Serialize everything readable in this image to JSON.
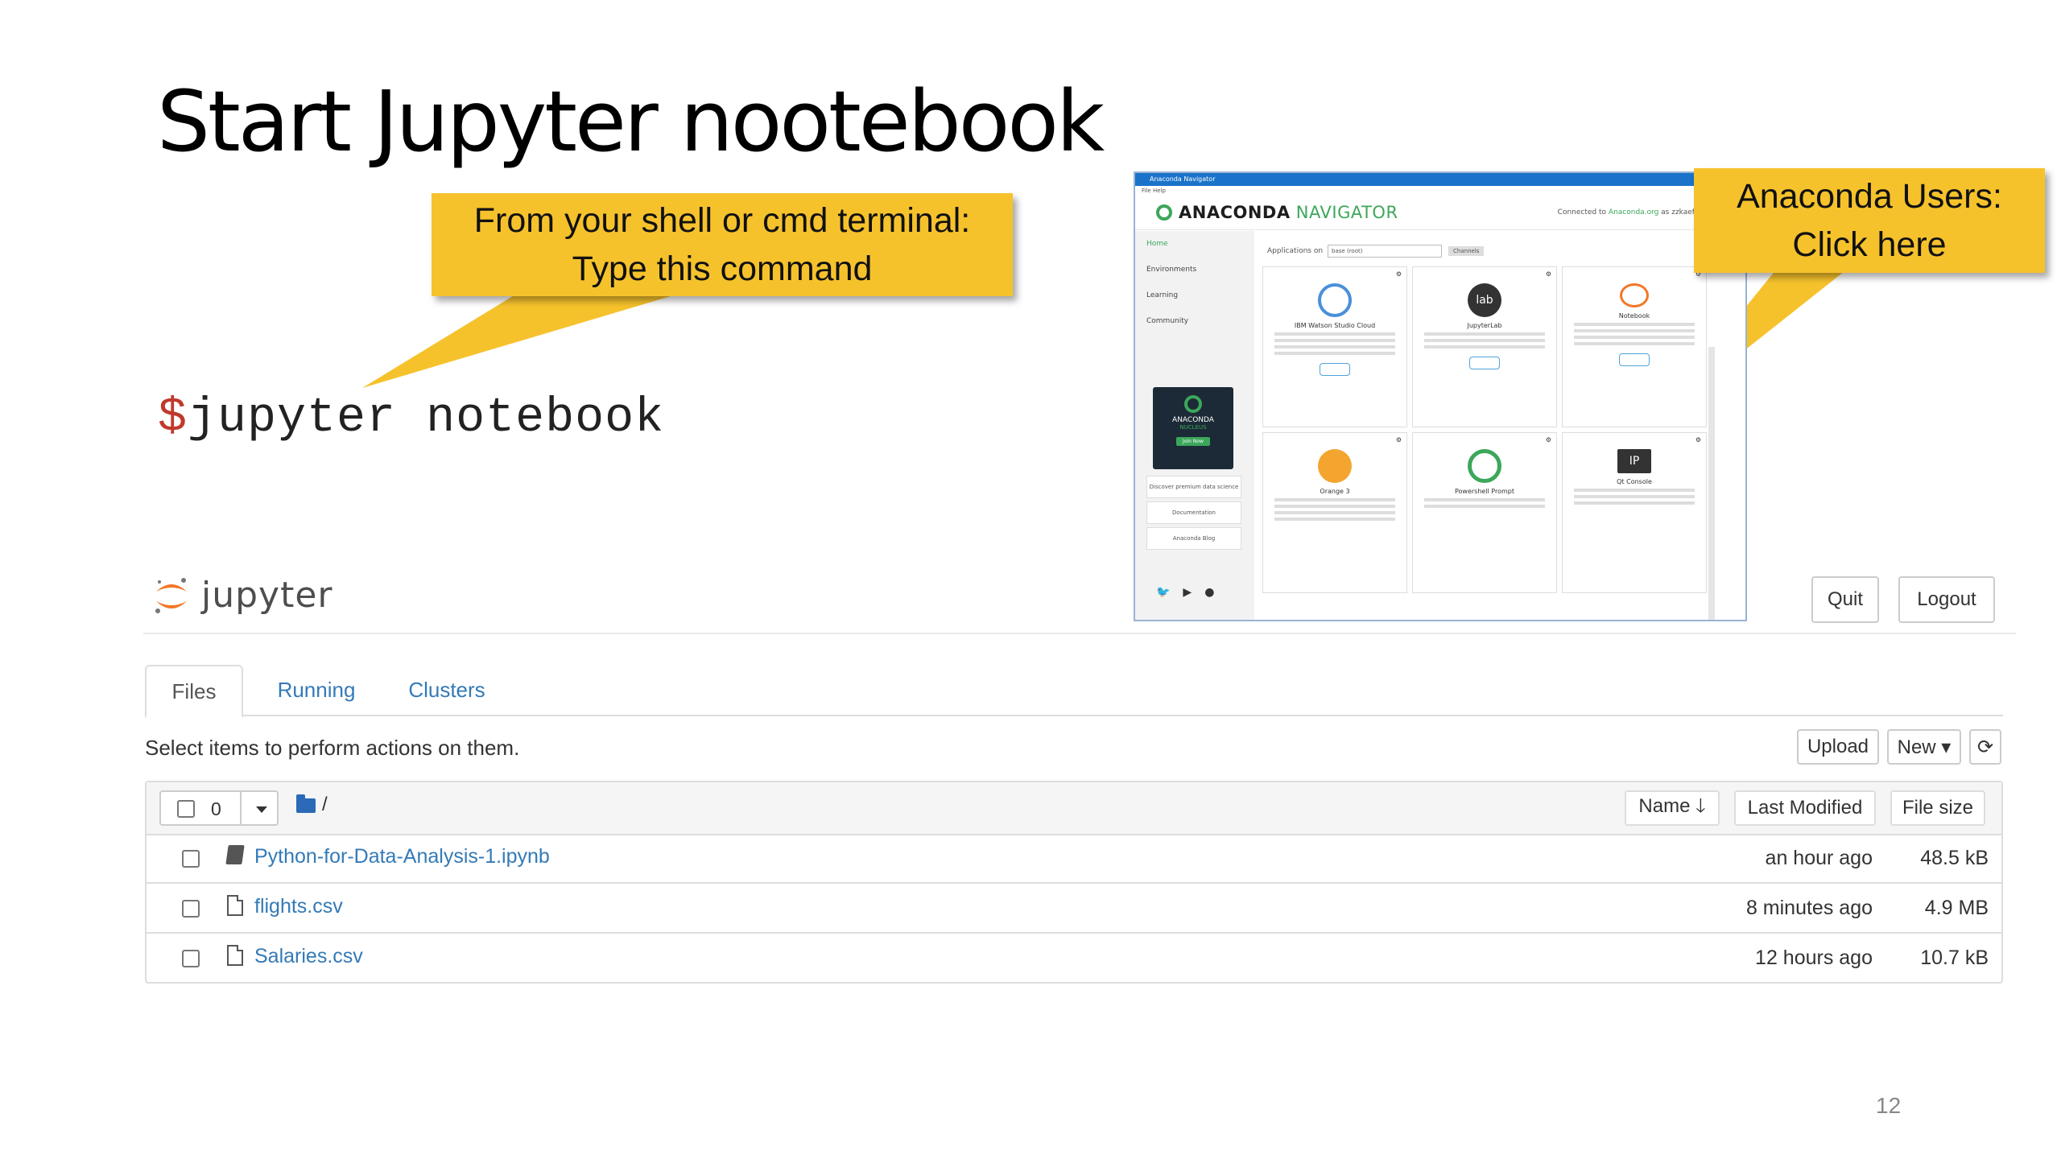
{
  "slide": {
    "title": "Start Jupyter nootebook",
    "number": "12",
    "callout_shell_line1": "From your shell or cmd terminal:",
    "callout_shell_line2": "Type this command",
    "callout_anaconda_line1": "Anaconda Users:",
    "callout_anaconda_line2": "Click here",
    "command_prompt": "$",
    "command_text": "jupyter notebook",
    "callout_color": "#f6c22c"
  },
  "navigator": {
    "window_title": "Anaconda Navigator",
    "menu": "File  Help",
    "brand_a": "ANACONDA",
    "brand_b": "NAVIGATOR",
    "connected_prefix": "Connected to",
    "connected_site": "Anaconda.org",
    "connected_suffix": "as zzkaeff",
    "sidebar": [
      "Home",
      "Environments",
      "Learning",
      "Community"
    ],
    "promo_title": "ANACONDA",
    "promo_sub": "NUCLEUS",
    "promo_button": "Join Now",
    "sidebar_links": [
      "Discover premium data science content",
      "Documentation",
      "Anaconda Blog"
    ],
    "applications_on_label": "Applications on",
    "env_select": "base (root)",
    "channels_button": "Channels",
    "apps": [
      {
        "name": "IBM Watson Studio Cloud",
        "icon": "watson-icon"
      },
      {
        "name": "JupyterLab",
        "icon": "jupyterlab-icon"
      },
      {
        "name": "Notebook",
        "icon": "jupyter-icon"
      },
      {
        "name": "Orange 3",
        "icon": "orange-icon"
      },
      {
        "name": "Powershell Prompt",
        "icon": "powershell-icon"
      },
      {
        "name": "Qt Console",
        "icon": "ipython-icon"
      }
    ],
    "launch_label": "Launch",
    "accent": "#3ca75a"
  },
  "jupyter": {
    "logo_text": "jupyter",
    "quit": "Quit",
    "logout": "Logout",
    "tabs": [
      "Files",
      "Running",
      "Clusters"
    ],
    "hint": "Select items to perform actions on them.",
    "upload": "Upload",
    "new": "New ▾",
    "refresh_icon": "refresh-icon",
    "selected_count": "0",
    "breadcrumb": "/",
    "col_name": "Name 🡓",
    "col_modified": "Last Modified",
    "col_size": "File size",
    "files": [
      {
        "name": "Python-for-Data-Analysis-1.ipynb",
        "modified": "an hour ago",
        "size": "48.5 kB",
        "type": "notebook"
      },
      {
        "name": "flights.csv",
        "modified": "8 minutes ago",
        "size": "4.9 MB",
        "type": "file"
      },
      {
        "name": "Salaries.csv",
        "modified": "12 hours ago",
        "size": "10.7 kB",
        "type": "file"
      }
    ],
    "link_color": "#337ab7",
    "logo_orange": "#f37726"
  }
}
